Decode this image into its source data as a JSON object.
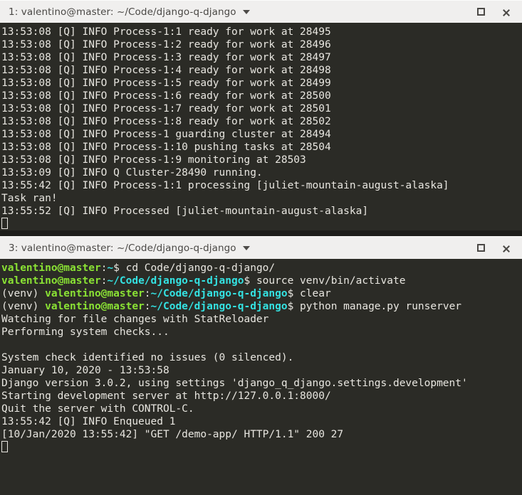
{
  "windows": [
    {
      "titlebar": {
        "title": "1: valentino@master: ~/Code/django-q-django",
        "dropdown_icon": "chevron-down-icon",
        "maximize_label": "Maximize",
        "close_label": "Close"
      },
      "lines": [
        {
          "segments": [
            {
              "text": "13:53:08 [Q] INFO Process-1:1 ready for work at 28495",
              "style": "plain"
            }
          ]
        },
        {
          "segments": [
            {
              "text": "13:53:08 [Q] INFO Process-1:2 ready for work at 28496",
              "style": "plain"
            }
          ]
        },
        {
          "segments": [
            {
              "text": "13:53:08 [Q] INFO Process-1:3 ready for work at 28497",
              "style": "plain"
            }
          ]
        },
        {
          "segments": [
            {
              "text": "13:53:08 [Q] INFO Process-1:4 ready for work at 28498",
              "style": "plain"
            }
          ]
        },
        {
          "segments": [
            {
              "text": "13:53:08 [Q] INFO Process-1:5 ready for work at 28499",
              "style": "plain"
            }
          ]
        },
        {
          "segments": [
            {
              "text": "13:53:08 [Q] INFO Process-1:6 ready for work at 28500",
              "style": "plain"
            }
          ]
        },
        {
          "segments": [
            {
              "text": "13:53:08 [Q] INFO Process-1:7 ready for work at 28501",
              "style": "plain"
            }
          ]
        },
        {
          "segments": [
            {
              "text": "13:53:08 [Q] INFO Process-1:8 ready for work at 28502",
              "style": "plain"
            }
          ]
        },
        {
          "segments": [
            {
              "text": "13:53:08 [Q] INFO Process-1 guarding cluster at 28494",
              "style": "plain"
            }
          ]
        },
        {
          "segments": [
            {
              "text": "13:53:08 [Q] INFO Process-1:10 pushing tasks at 28504",
              "style": "plain"
            }
          ]
        },
        {
          "segments": [
            {
              "text": "13:53:08 [Q] INFO Process-1:9 monitoring at 28503",
              "style": "plain"
            }
          ]
        },
        {
          "segments": [
            {
              "text": "13:53:09 [Q] INFO Q Cluster-28490 running.",
              "style": "plain"
            }
          ]
        },
        {
          "segments": [
            {
              "text": "13:55:42 [Q] INFO Process-1:1 processing [juliet-mountain-august-alaska]",
              "style": "plain"
            }
          ]
        },
        {
          "segments": [
            {
              "text": "Task ran!",
              "style": "plain"
            }
          ]
        },
        {
          "segments": [
            {
              "text": "13:55:52 [Q] INFO Processed [juliet-mountain-august-alaska]",
              "style": "plain"
            }
          ]
        },
        {
          "segments": [],
          "cursor": true
        }
      ]
    },
    {
      "titlebar": {
        "title": "3: valentino@master: ~/Code/django-q-django",
        "dropdown_icon": "chevron-down-icon",
        "maximize_label": "Maximize",
        "close_label": "Close"
      },
      "lines": [
        {
          "segments": [
            {
              "text": "valentino@master",
              "style": "green"
            },
            {
              "text": ":",
              "style": "plain"
            },
            {
              "text": "~",
              "style": "cyan"
            },
            {
              "text": "$ cd Code/django-q-django/",
              "style": "plain"
            }
          ]
        },
        {
          "segments": [
            {
              "text": "valentino@master",
              "style": "green"
            },
            {
              "text": ":",
              "style": "plain"
            },
            {
              "text": "~/Code/django-q-django",
              "style": "cyan"
            },
            {
              "text": "$ source venv/bin/activate",
              "style": "plain"
            }
          ]
        },
        {
          "segments": [
            {
              "text": "(venv) ",
              "style": "plain"
            },
            {
              "text": "valentino@master",
              "style": "green"
            },
            {
              "text": ":",
              "style": "plain"
            },
            {
              "text": "~/Code/django-q-django",
              "style": "cyan"
            },
            {
              "text": "$ clear",
              "style": "plain"
            }
          ]
        },
        {
          "segments": [
            {
              "text": "(venv) ",
              "style": "plain"
            },
            {
              "text": "valentino@master",
              "style": "green"
            },
            {
              "text": ":",
              "style": "plain"
            },
            {
              "text": "~/Code/django-q-django",
              "style": "cyan"
            },
            {
              "text": "$ python manage.py runserver",
              "style": "plain"
            }
          ]
        },
        {
          "segments": [
            {
              "text": "Watching for file changes with StatReloader",
              "style": "plain"
            }
          ]
        },
        {
          "segments": [
            {
              "text": "Performing system checks...",
              "style": "plain"
            }
          ]
        },
        {
          "segments": []
        },
        {
          "segments": [
            {
              "text": "System check identified no issues (0 silenced).",
              "style": "plain"
            }
          ]
        },
        {
          "segments": [
            {
              "text": "January 10, 2020 - 13:53:58",
              "style": "plain"
            }
          ]
        },
        {
          "segments": [
            {
              "text": "Django version 3.0.2, using settings 'django_q_django.settings.development'",
              "style": "plain"
            }
          ]
        },
        {
          "segments": [
            {
              "text": "Starting development server at http://127.0.0.1:8000/",
              "style": "plain"
            }
          ]
        },
        {
          "segments": [
            {
              "text": "Quit the server with CONTROL-C.",
              "style": "plain"
            }
          ]
        },
        {
          "segments": [
            {
              "text": "13:55:42 [Q] INFO Enqueued 1",
              "style": "plain"
            }
          ]
        },
        {
          "segments": [
            {
              "text": "[10/Jan/2020 13:55:42] \"GET /demo-app/ HTTP/1.1\" 200 27",
              "style": "plain"
            }
          ]
        },
        {
          "segments": [],
          "cursor": true
        }
      ]
    }
  ],
  "theme": {
    "terminal_background": "#2b2b26",
    "terminal_foreground": "#e8e6e0",
    "prompt_user_color": "#8ae234",
    "prompt_path_color": "#34e2e2",
    "titlebar_background": "#f0efee",
    "titlebar_text_color": "#4a4845",
    "desktop_background": "#1d1d1a"
  }
}
